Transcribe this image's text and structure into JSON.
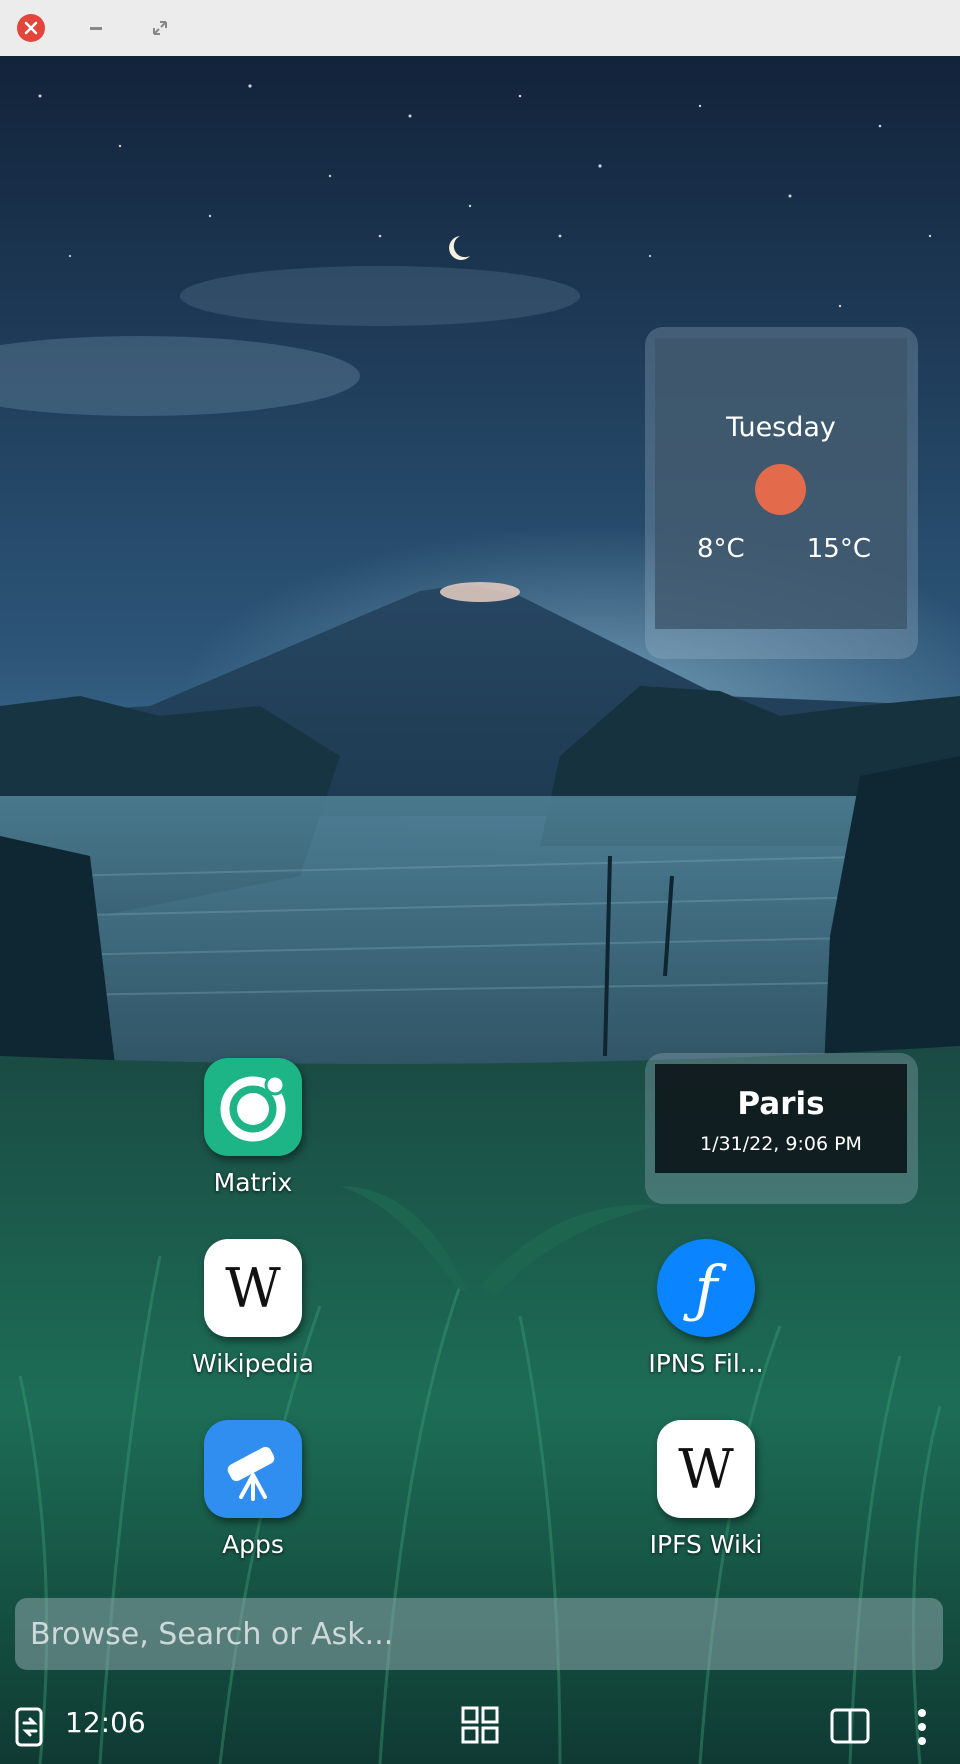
{
  "titlebar": {
    "close_icon": "close-icon",
    "minimize_icon": "minimize-icon",
    "maximize_icon": "maximize-icon"
  },
  "weather": {
    "day": "Tuesday",
    "condition_icon": "sun-icon",
    "low": "8°C",
    "high": "15°C"
  },
  "clock_widget": {
    "city": "Paris",
    "datetime": "1/31/22, 9:06 PM"
  },
  "apps": [
    {
      "label": "Matrix",
      "icon": "matrix-icon",
      "color": "#1db586"
    },
    {
      "label": "Wikipedia",
      "icon": "wikipedia-icon",
      "color": "#ffffff"
    },
    {
      "label": "IPNS Fil...",
      "icon": "filecoin-icon",
      "color": "#0a84ff"
    },
    {
      "label": "Apps",
      "icon": "telescope-icon",
      "color": "#2f8ef0"
    },
    {
      "label": "IPFS Wiki",
      "icon": "wikipedia-icon",
      "color": "#ffffff"
    }
  ],
  "search": {
    "placeholder": "Browse, Search or Ask...",
    "value": ""
  },
  "bottom_bar": {
    "time": "12:06",
    "left_icon": "sync-icon",
    "grid_icon": "grid-icon",
    "split_icon": "split-view-icon",
    "menu_icon": "more-vertical-icon"
  }
}
